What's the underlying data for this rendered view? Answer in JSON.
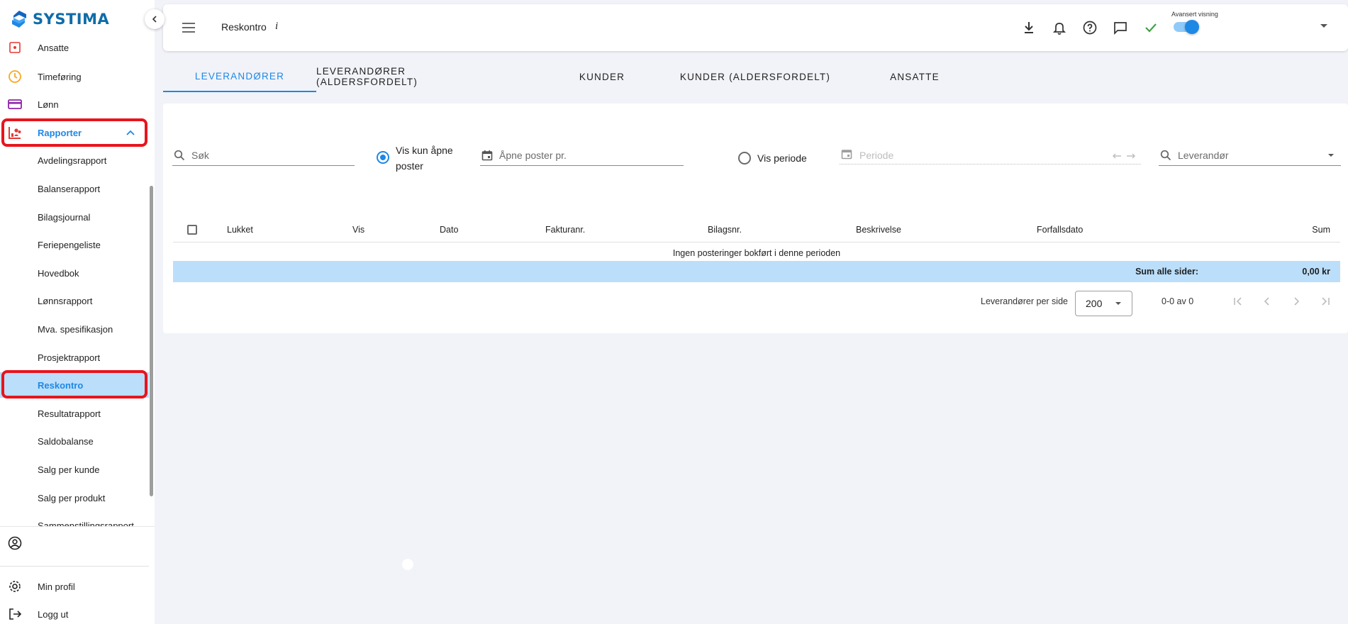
{
  "app": {
    "brand": "SYSTIMA",
    "brand_color": "#0f6ca8",
    "accent": "#1e88e5",
    "highlight": "#e8141d"
  },
  "sidebar": {
    "top_items": [
      {
        "label": "Ansatte",
        "icon": "calendar-person-icon",
        "icon_color": "#e53935"
      },
      {
        "label": "Timeføring",
        "icon": "clock-icon",
        "icon_color": "#f9a825"
      },
      {
        "label": "Lønn",
        "icon": "card-icon",
        "icon_color": "#8e24aa"
      },
      {
        "label": "Rapporter",
        "icon": "report-people-icon",
        "icon_color": "#e53935"
      }
    ],
    "sub_items": [
      "Avdelingsrapport",
      "Balanserapport",
      "Bilagsjournal",
      "Feriepengeliste",
      "Hovedbok",
      "Lønnsrapport",
      "Mva. spesifikasjon",
      "Prosjektrapport",
      "Reskontro",
      "Resultatrapport",
      "Saldobalanse",
      "Salg per kunde",
      "Salg per produkt",
      "Sammenstillingsrapport"
    ],
    "bottom": {
      "profile_label": "Min profil",
      "logout_label": "Logg ut"
    }
  },
  "topbar": {
    "title": "Reskontro",
    "info": "i",
    "advanced_label": "Avansert visning",
    "advanced_on": true
  },
  "tabs": [
    "Leverandører",
    "Leverandører (aldersfordelt)",
    "Kunder",
    "Kunder (aldersfordelt)",
    "Ansatte"
  ],
  "filters": {
    "search_placeholder": "Søk",
    "radio_open_label": "Vis kun åpne poster",
    "radio_open_line1": "Vis kun åpne",
    "radio_open_line2": "poster",
    "open_date_placeholder": "Åpne poster pr.",
    "radio_period_label": "Vis periode",
    "period_placeholder": "Periode",
    "supplier_placeholder": "Leverandør"
  },
  "table": {
    "columns": [
      "Lukket",
      "Vis",
      "Dato",
      "Fakturanr.",
      "Bilagsnr.",
      "Beskrivelse",
      "Forfallsdato",
      "Sum"
    ],
    "empty_text": "Ingen posteringer bokført i denne perioden",
    "sum_label": "Sum alle sider:",
    "sum_value": "0,00 kr"
  },
  "pagination": {
    "per_page_label": "Leverandører per side",
    "per_page_value": "200",
    "range": "0-0 av 0"
  }
}
